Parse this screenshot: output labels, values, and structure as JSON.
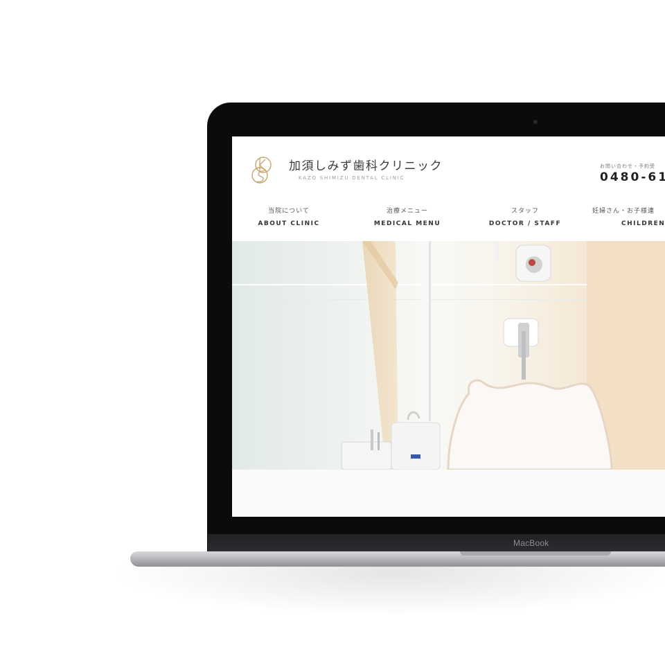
{
  "device": {
    "brand_label": "MacBook"
  },
  "site": {
    "title": "加須しみず歯科クリニック",
    "subtitle": "KAZO SHIMIZU DENTAL CLINIC",
    "contact_label": "お問い合わせ・予約受",
    "phone": "0480-61-",
    "logo_icon": "ks-monogram-logo",
    "accent_color": "#c8a46a"
  },
  "nav": [
    {
      "ja": "当院について",
      "en": "ABOUT CLINIC"
    },
    {
      "ja": "治療メニュー",
      "en": "MEDICAL MENU"
    },
    {
      "ja": "スタッフ",
      "en": "DOCTOR / STAFF"
    },
    {
      "ja": "妊婦さん・お子様連",
      "en": "CHILDREN"
    }
  ],
  "hero": {
    "image_icon": "dental-chair-photo"
  }
}
